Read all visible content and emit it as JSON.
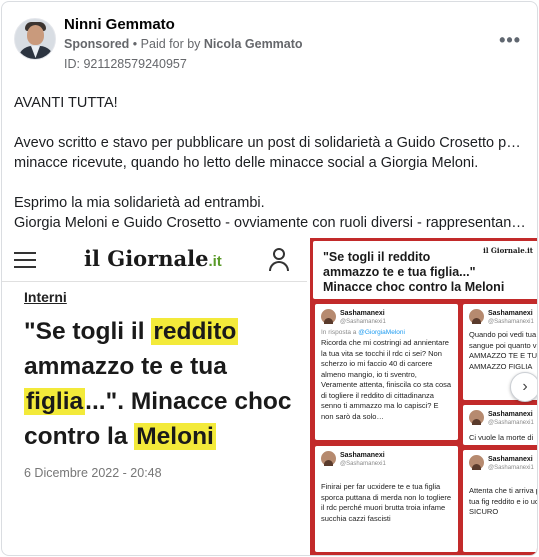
{
  "post": {
    "author": "Ninni Gemmato",
    "sponsored_label": "Sponsored",
    "separator": "•",
    "paid_for_by_prefix": "Paid for by",
    "payer": "Nicola Gemmato",
    "id_label": "ID: 921128579240957",
    "more_label": "•••"
  },
  "body": {
    "line1": "AVANTI TUTTA!",
    "line2": "Avevo scritto e stavo per pubblicare un post di solidarietà a Guido Crosetto per le",
    "line3": "minacce ricevute, quando ho letto delle minacce social a Giorgia Meloni.",
    "line4": "Esprimo la mia solidarietà ad entrambi.",
    "line5": "Giorgia Meloni e Guido Crosetto - ovviamente con ruoli diversi - rappresentano in…"
  },
  "article": {
    "logo_main": "il Giornale",
    "logo_suffix": ".it",
    "section": "Interni",
    "headline": {
      "p1": "\"Se togli il ",
      "h1": "reddito",
      "p2": " ammazzo te e tua ",
      "h2": "figlia",
      "p3": "...\". Minacce choc contro la ",
      "h3": "Meloni"
    },
    "date": "6 Dicembre 2022 - 20:48"
  },
  "collage": {
    "brand": "il Giornale.it",
    "title_line1": "\"Se togli il reddito",
    "title_line2": "ammazzo te e tua figlia...\"",
    "title_line3": "Minacce choc contro la Meloni",
    "tweets": [
      {
        "name": "Sashamanexi",
        "handle": "@Sashamanexi1",
        "reply_prefix": "In risposta a",
        "reply_to": "@GiorgiaMeloni",
        "text": "Ricorda che mi costringi ad annientare la tua vita se tocchi il rdc ci sei? Non scherzo io mi faccio 40 di carcere almeno mangio, io ti sventro, Veramente attenta, finiscila co sta cosa di togliere il reddito di cittadinanza senno ti ammazzo ma lo capisci? E non sarò da solo…"
      },
      {
        "name": "Sashamanexi",
        "handle": "@Sashamanexi1",
        "text": "Quando poi vedi tua pozza di sangue poi quanto vuoi COGLIO AMMAZZO TE E TU Ripeto AMMAZZO FIGLIA"
      },
      {
        "name": "Sashamanexi",
        "handle": "@Sashamanexi1",
        "text": "Ci vuole la morte di"
      },
      {
        "name": "Sashamanexi",
        "handle": "@Sashamanexi1",
        "text": "Finirai per far ucxidere te e tua figlia sporca puttana di merda non lo togliere il rdc perché muori brutta troia infame succhia cazzi fascisti"
      },
      {
        "name": "Sashamanexi",
        "handle": "@Sashamanexi1",
        "text": "Attenta che ti arriva pancia a te e tua fig reddito e io uccido SICURO"
      }
    ],
    "next_label": "›"
  }
}
